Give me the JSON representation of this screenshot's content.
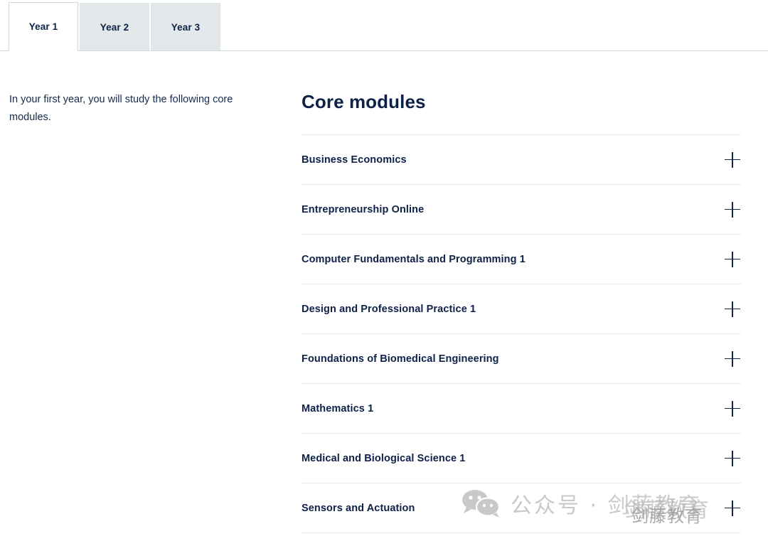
{
  "tabs": [
    {
      "label": "Year 1",
      "active": true
    },
    {
      "label": "Year 2",
      "active": false
    },
    {
      "label": "Year 3",
      "active": false
    }
  ],
  "left": {
    "intro": "In your first year, you will study the following core modules."
  },
  "main": {
    "section_title": "Core modules",
    "modules": [
      {
        "label": "Business Economics",
        "toggle": "plus-icon"
      },
      {
        "label": "Entrepreneurship Online",
        "toggle": "plus-icon"
      },
      {
        "label": "Computer Fundamentals and Programming 1",
        "toggle": "plus-icon"
      },
      {
        "label": "Design and Professional Practice 1",
        "toggle": "plus-icon"
      },
      {
        "label": "Foundations of Biomedical Engineering",
        "toggle": "plus-icon"
      },
      {
        "label": "Mathematics 1",
        "toggle": "plus-icon"
      },
      {
        "label": "Medical and Biological Science 1",
        "toggle": "plus-icon"
      },
      {
        "label": "Sensors and Actuation",
        "toggle": "plus-icon"
      }
    ]
  },
  "watermark": {
    "icon": "wechat-icon",
    "text": "公众号 · 剑藤教育",
    "overlay_text": "剑藤教育",
    "overlay_text2": "剑藤教育"
  },
  "colors": {
    "navy": "#0e2148",
    "tab_inactive_bg": "#e3e8ea",
    "divider": "#e7e9ea",
    "watermark_gray": "#c9c9c9"
  }
}
